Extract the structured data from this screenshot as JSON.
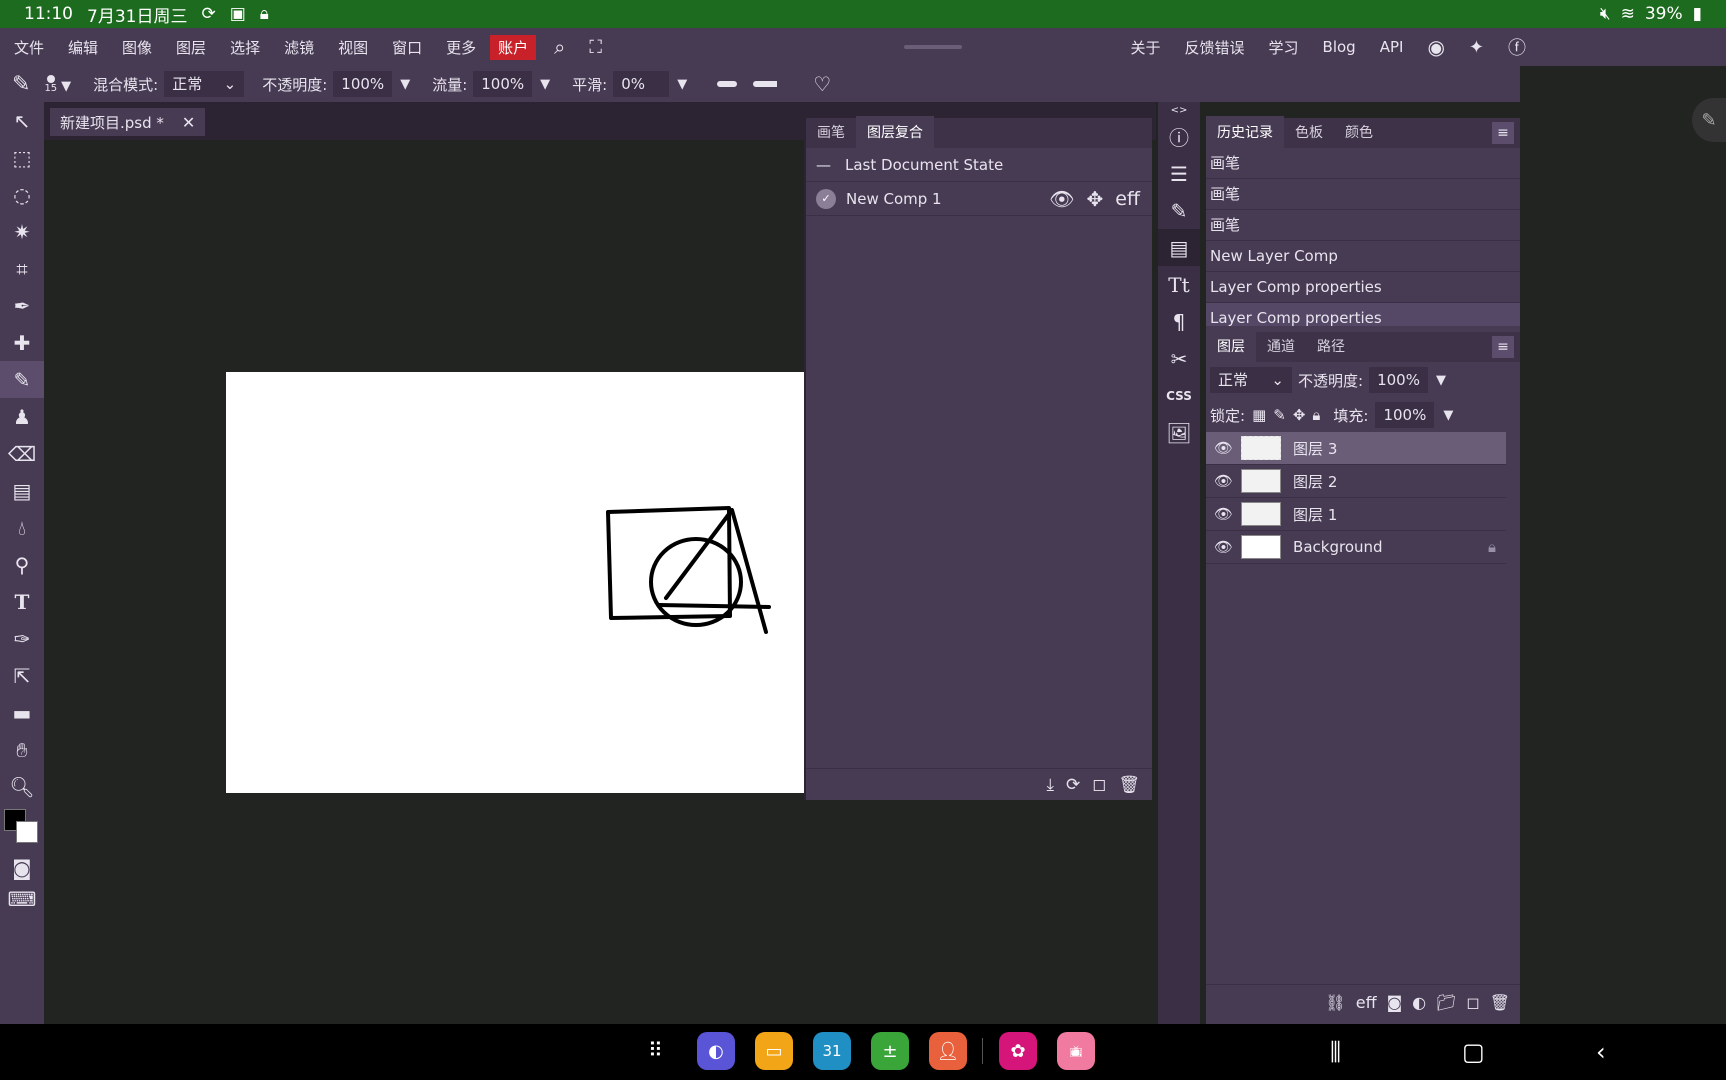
{
  "status": {
    "time": "11:10",
    "date": "7月31日周三",
    "battery": "39%"
  },
  "menu": {
    "items": [
      "文件",
      "编辑",
      "图像",
      "图层",
      "选择",
      "滤镜",
      "视图",
      "窗口",
      "更多"
    ],
    "account": "账户",
    "right_items": [
      "关于",
      "反馈错误",
      "学习",
      "Blog",
      "API"
    ]
  },
  "tool_options": {
    "brush_size": "15",
    "blend_label": "混合模式:",
    "blend_value": "正常",
    "opacity_label": "不透明度:",
    "opacity_value": "100%",
    "flow_label": "流量:",
    "flow_value": "100%",
    "smooth_label": "平滑:",
    "smooth_value": "0%"
  },
  "document": {
    "tab_title": "新建项目.psd *"
  },
  "layer_comps_panel": {
    "tabs": [
      "画笔",
      "图层复合"
    ],
    "active_tab": 1,
    "rows": [
      {
        "label": "Last Document State"
      },
      {
        "label": "New Comp 1",
        "extra": "eff"
      }
    ]
  },
  "history_panel": {
    "tabs": [
      "历史记录",
      "色板",
      "颜色"
    ],
    "items": [
      "画笔",
      "画笔",
      "画笔",
      "New Layer Comp",
      "Layer Comp properties",
      "Layer Comp properties"
    ]
  },
  "layers_panel": {
    "tabs": [
      "图层",
      "通道",
      "路径"
    ],
    "blend_mode": "正常",
    "opacity_label": "不透明度:",
    "opacity_value": "100%",
    "lock_label": "锁定:",
    "fill_label": "填充:",
    "fill_value": "100%",
    "layers": [
      {
        "name": "图层 3",
        "selected": true
      },
      {
        "name": "图层 2",
        "selected": false
      },
      {
        "name": "图层 1",
        "selected": false
      },
      {
        "name": "Background",
        "selected": false,
        "locked": true
      }
    ],
    "footer_eff": "eff"
  },
  "right_iconbar": {
    "css_label": "CSS"
  },
  "dock": {
    "calendar_day": "31"
  },
  "colors": {
    "accent": "#c8212a",
    "panel": "#473b54",
    "status_bar": "#1d6b1f"
  }
}
